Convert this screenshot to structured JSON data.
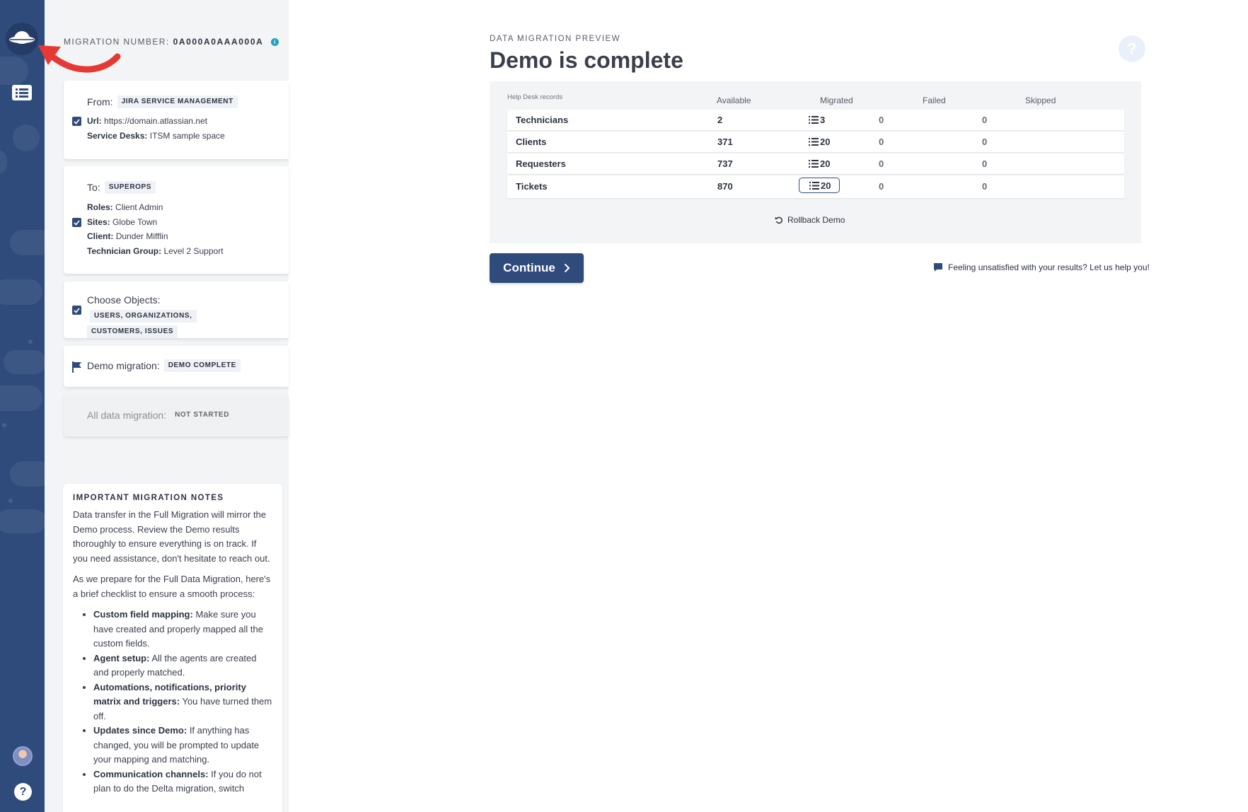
{
  "sidebar": {
    "logo_icon": "planet-logo-icon",
    "list_icon": "list-icon",
    "avatar": "user-avatar",
    "help_label": "?"
  },
  "header": {
    "migration_number_label": "MIGRATION NUMBER:",
    "migration_number": "0A000A0AAA000A",
    "info_icon": "info-icon"
  },
  "steps": {
    "from": {
      "label": "From:",
      "value": "JIRA SERVICE MANAGEMENT",
      "details": [
        {
          "key": "Url:",
          "value": "https://domain.atlassian.net"
        },
        {
          "key": "Service Desks:",
          "value": "ITSM sample space"
        }
      ]
    },
    "to": {
      "label": "To:",
      "value": "SUPEROPS",
      "details": [
        {
          "key": "Roles:",
          "value": "Client Admin"
        },
        {
          "key": "Sites:",
          "value": "Globe Town"
        },
        {
          "key": "Client:",
          "value": "Dunder Mifflin"
        },
        {
          "key": "Technician Group:",
          "value": "Level 2 Support"
        }
      ]
    },
    "objects": {
      "label": "Choose Objects:",
      "value_line1": "USERS, ORGANIZATIONS,",
      "value_line2": "CUSTOMERS, ISSUES"
    },
    "demo": {
      "label": "Demo migration:",
      "value": "DEMO COMPLETE"
    },
    "full": {
      "label": "All data migration:",
      "value": "NOT STARTED"
    }
  },
  "notes": {
    "title": "IMPORTANT MIGRATION NOTES",
    "para1": "Data transfer in the Full Migration will mirror the Demo process. Review the Demo results thoroughly to ensure everything is on track. If you need assistance, don't hesitate to reach out.",
    "para2": "As we prepare for the Full Data Migration, here's a brief checklist to ensure a smooth process:",
    "items": [
      {
        "bold": "Custom field mapping:",
        "text": " Make sure you have created and properly mapped all the custom fields."
      },
      {
        "bold": "Agent setup:",
        "text": " All the agents are created and properly matched."
      },
      {
        "bold": "Automations, notifications, priority matrix and triggers:",
        "text": " You have turned them off."
      },
      {
        "bold": "Updates since Demo:",
        "text": " If anything has changed, you will be prompted to update your mapping and matching."
      },
      {
        "bold": "Communication channels:",
        "text": " If you do not plan to do the Delta migration, switch"
      }
    ]
  },
  "main": {
    "eyebrow": "DATA MIGRATION PREVIEW",
    "title": "Demo is complete",
    "help_label": "?",
    "table": {
      "headers": {
        "records": "Help Desk records",
        "available": "Available",
        "migrated": "Migrated",
        "failed": "Failed",
        "skipped": "Skipped"
      },
      "rows": [
        {
          "name": "Technicians",
          "available": "2",
          "migrated": "3",
          "failed": "0",
          "skipped": "0"
        },
        {
          "name": "Clients",
          "available": "371",
          "migrated": "20",
          "failed": "0",
          "skipped": "0"
        },
        {
          "name": "Requesters",
          "available": "737",
          "migrated": "20",
          "failed": "0",
          "skipped": "0"
        },
        {
          "name": "Tickets",
          "available": "870",
          "migrated": "20",
          "failed": "0",
          "skipped": "0"
        }
      ]
    },
    "rollback_label": "Rollback Demo",
    "continue_label": "Continue",
    "feedback_label": "Feeling unsatisfied with your results? Let us help you!"
  },
  "colors": {
    "rail": "#2f4b7c",
    "accent": "#2f4b7c",
    "annotation": "#e53935",
    "info": "#1fa0b5"
  }
}
